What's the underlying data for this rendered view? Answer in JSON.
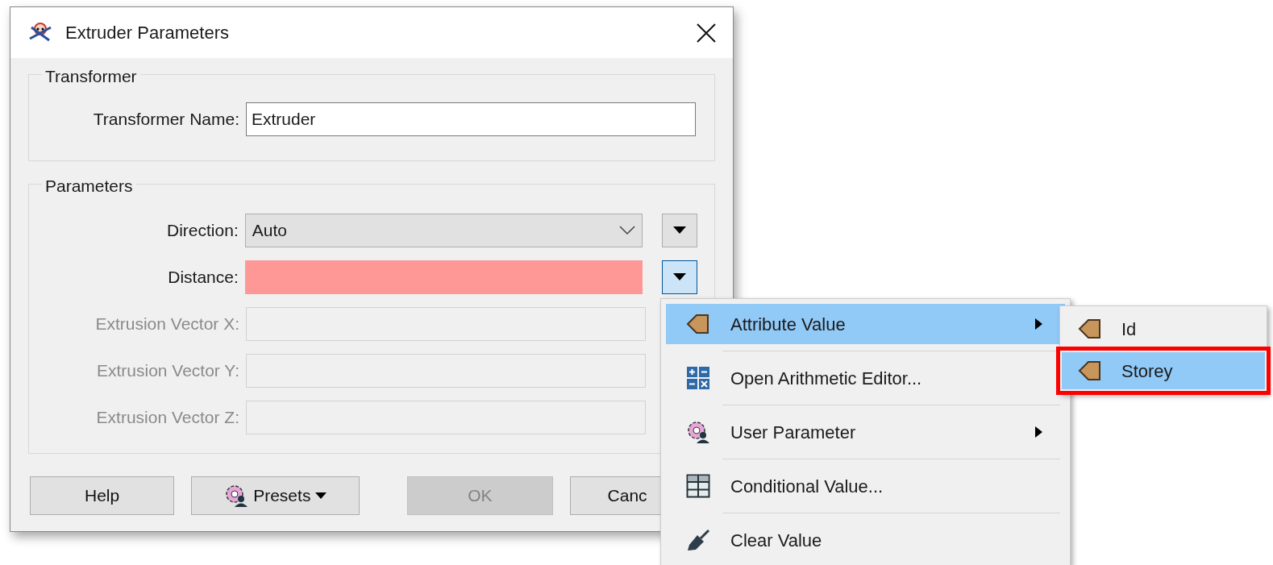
{
  "window": {
    "title": "Extruder Parameters"
  },
  "transformer_group": {
    "title": "Transformer",
    "name_label": "Transformer Name:",
    "name_value": "Extruder"
  },
  "parameters_group": {
    "title": "Parameters",
    "rows": [
      {
        "label": "Direction:",
        "kind": "dropdown",
        "value": "Auto",
        "disabled": false
      },
      {
        "label": "Distance:",
        "kind": "text",
        "disabled": false,
        "invalid": true,
        "menu_open": true
      },
      {
        "label": "Extrusion Vector X:",
        "kind": "text",
        "disabled": true
      },
      {
        "label": "Extrusion Vector Y:",
        "kind": "text",
        "disabled": true
      },
      {
        "label": "Extrusion Vector Z:",
        "kind": "text",
        "disabled": true
      }
    ]
  },
  "buttons": [
    {
      "label": "Help",
      "kind": "plain",
      "disabled": false
    },
    {
      "label": "Presets",
      "kind": "presets",
      "disabled": false
    },
    {
      "label": "OK",
      "kind": "plain",
      "disabled": true
    },
    {
      "label": "Canc",
      "kind": "plain",
      "disabled": false
    }
  ],
  "context_menu": {
    "items": [
      {
        "label": "Attribute Value",
        "kind": "attribute",
        "selected": true,
        "submenu": true
      },
      {
        "label": "Open Arithmetic Editor...",
        "kind": "arithmetic",
        "selected": false,
        "submenu": false
      },
      {
        "label": "User Parameter",
        "kind": "user-parameter",
        "selected": false,
        "submenu": true
      },
      {
        "label": "Conditional Value...",
        "kind": "conditional",
        "selected": false,
        "submenu": false
      },
      {
        "label": "Clear Value",
        "kind": "clear",
        "selected": false,
        "submenu": false
      }
    ]
  },
  "submenu": {
    "items": [
      {
        "label": "Id",
        "selected": false,
        "annotated": false
      },
      {
        "label": "Storey",
        "selected": true,
        "annotated": true
      }
    ]
  }
}
